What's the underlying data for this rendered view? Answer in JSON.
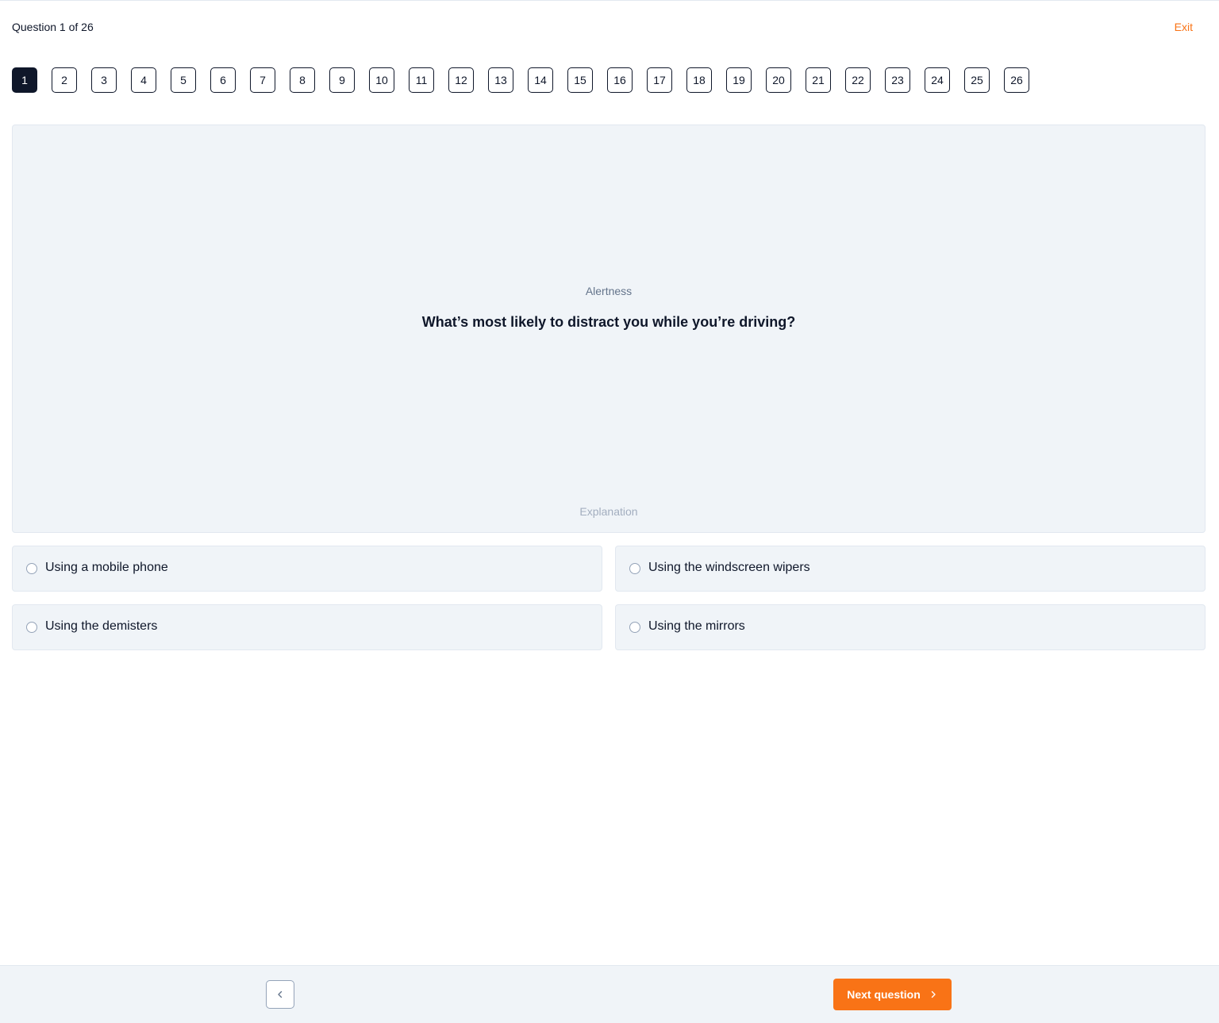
{
  "header": {
    "counter": "Question 1 of 26",
    "exit_label": "Exit"
  },
  "question_nav": {
    "current": 1,
    "items": [
      "1",
      "2",
      "3",
      "4",
      "5",
      "6",
      "7",
      "8",
      "9",
      "10",
      "11",
      "12",
      "13",
      "14",
      "15",
      "16",
      "17",
      "18",
      "19",
      "20",
      "21",
      "22",
      "23",
      "24",
      "25",
      "26"
    ]
  },
  "question": {
    "category": "Alertness",
    "text": "What’s most likely to distract you while you’re driving?",
    "explanation_label": "Explanation"
  },
  "answers": [
    {
      "label": "Using a mobile phone",
      "selected": false
    },
    {
      "label": "Using the windscreen wipers",
      "selected": false
    },
    {
      "label": "Using the demisters",
      "selected": false
    },
    {
      "label": "Using the mirrors",
      "selected": false
    }
  ],
  "footer": {
    "next_label": "Next question",
    "prev_icon": "chevron-left-icon",
    "next_icon": "chevron-right-icon"
  },
  "colors": {
    "accent": "#f97316",
    "dark": "#0f172a",
    "panel": "#f0f4f8"
  }
}
